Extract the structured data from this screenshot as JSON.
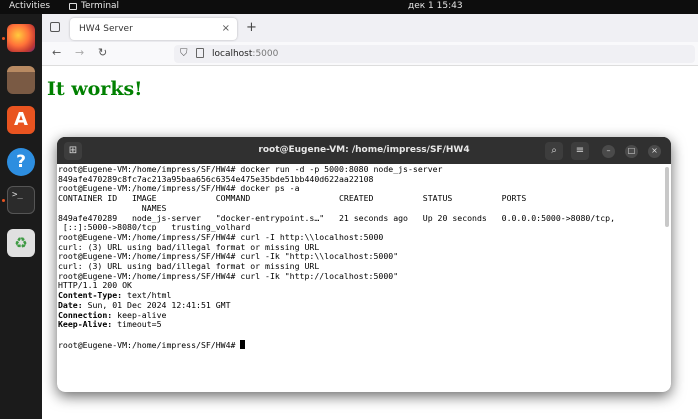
{
  "topbar": {
    "activities": "Activities",
    "app_name": "Terminal",
    "clock": "дек 1  15:43"
  },
  "dock": {
    "items": [
      {
        "name": "firefox-icon",
        "color": "#e66000"
      },
      {
        "name": "files-icon",
        "color": "#9a6a4a"
      },
      {
        "name": "software-icon",
        "color": "#e95420"
      },
      {
        "name": "help-icon",
        "color": "#2d8ee0"
      },
      {
        "name": "terminal-icon",
        "color": "#2b2b2b"
      },
      {
        "name": "trash-icon",
        "color": "#6aa96f"
      }
    ]
  },
  "browser": {
    "tab_title": "HW4 Server",
    "tab_close": "×",
    "new_tab": "+",
    "back": "←",
    "forward": "→",
    "reload": "↻",
    "url_host": "localhost",
    "url_port": ":5000",
    "page_heading": "It works!"
  },
  "terminal": {
    "title": "root@Eugene-VM: /home/impress/SF/HW4",
    "lines": [
      "root@Eugene-VM:/home/impress/SF/HW4# docker run -d -p 5000:8080 node_js-server",
      "849afe470289c8fc7ac213a95baa656c6354e475e35bde51bb440d622aa22108",
      "root@Eugene-VM:/home/impress/SF/HW4# docker ps -a",
      "CONTAINER ID   IMAGE            COMMAND                  CREATED          STATUS          PORTS",
      "                 NAMES",
      "849afe470289   node_js-server   \"docker-entrypoint.s…\"   21 seconds ago   Up 20 seconds   0.0.0.0:5000->8080/tcp,",
      " [::]:5000->8080/tcp   trusting_volhard",
      "root@Eugene-VM:/home/impress/SF/HW4# curl -I http:\\\\localhost:5000",
      "curl: (3) URL using bad/illegal format or missing URL",
      "root@Eugene-VM:/home/impress/SF/HW4# curl -Ik \"http:\\\\localhost:5000\"",
      "curl: (3) URL using bad/illegal format or missing URL",
      "root@Eugene-VM:/home/impress/SF/HW4# curl -Ik \"http://localhost:5000\"",
      "HTTP/1.1 200 OK"
    ],
    "headers": [
      {
        "key": "Content-Type:",
        "value": " text/html"
      },
      {
        "key": "Date:",
        "value": " Sun, 01 Dec 2024 12:41:51 GMT"
      },
      {
        "key": "Connection:",
        "value": " keep-alive"
      },
      {
        "key": "Keep-Alive:",
        "value": " timeout=5"
      }
    ],
    "blank": "",
    "prompt": "root@Eugene-VM:/home/impress/SF/HW4# "
  }
}
